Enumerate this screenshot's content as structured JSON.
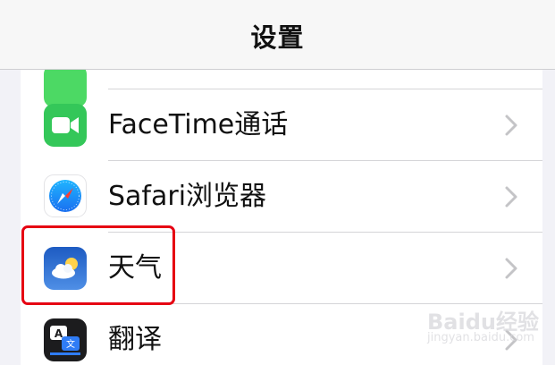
{
  "navbar": {
    "title": "设置"
  },
  "settings_items": [
    {
      "label": "FaceTime通话",
      "icon": "facetime-icon"
    },
    {
      "label": "Safari浏览器",
      "icon": "safari-icon"
    },
    {
      "label": "天气",
      "icon": "weather-icon",
      "highlighted": true
    },
    {
      "label": "翻译",
      "icon": "translate-icon"
    }
  ],
  "colors": {
    "facetime_green": "#34c759",
    "weather_blue": "#2f6fd3",
    "highlight_red": "#e60012",
    "chevron": "#c4c4c7"
  },
  "watermark": {
    "text": "Baidu经验",
    "sub": "jingyan.baidu.com"
  }
}
